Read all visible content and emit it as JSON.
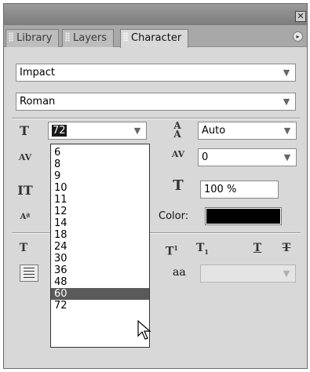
{
  "window": {
    "close_glyph": "✕",
    "menu_glyph": "▸"
  },
  "tabs": [
    {
      "label": "Library",
      "active": false
    },
    {
      "label": "Layers",
      "active": false
    },
    {
      "label": "Character",
      "active": true
    }
  ],
  "font": {
    "family": "Impact",
    "style": "Roman"
  },
  "controls": {
    "font_size": "72",
    "leading": "Auto",
    "kerning": "0",
    "horizontal_scale": "100 %",
    "color_label": "Color:",
    "color_value": "#000000",
    "anti_alias_glyph": "aa"
  },
  "size_list": {
    "items": [
      "6",
      "8",
      "9",
      "10",
      "11",
      "12",
      "14",
      "18",
      "24",
      "30",
      "36",
      "48",
      "60",
      "72"
    ],
    "highlighted": "60"
  },
  "colors": {
    "panel_bg": "#d8d8d8",
    "highlight": "#5a5a5a",
    "swatch": "#000000"
  },
  "icons": {
    "font_size": "font-size-icon",
    "leading": "leading-icon",
    "tracking": "tracking-icon",
    "kerning": "kerning-icon",
    "vertical_scale": "vertical-scale-icon",
    "horizontal_scale": "horizontal-scale-icon",
    "baseline_shift": "baseline-shift-icon"
  }
}
